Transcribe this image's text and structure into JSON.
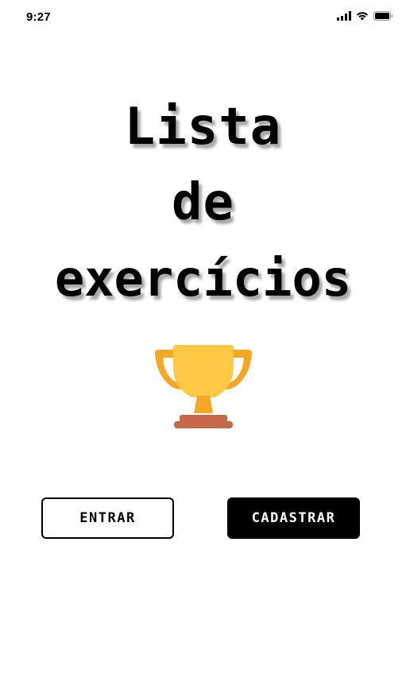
{
  "status_bar": {
    "time": "9:27",
    "icons": [
      "cellular-signal-icon",
      "wifi-icon",
      "battery-icon"
    ]
  },
  "title": {
    "line1": "Lista",
    "line2": "de",
    "line3": "exercícios"
  },
  "hero_icon": "trophy-icon",
  "buttons": {
    "login_label": "ENTRAR",
    "register_label": "CADASTRAR"
  },
  "colors": {
    "background": "#ffffff",
    "text": "#000000",
    "primary_button_bg": "#000000",
    "primary_button_text": "#ffffff",
    "trophy_gold": "#FFC845",
    "trophy_handles": "#F5A623",
    "trophy_base": "#C8684A"
  }
}
